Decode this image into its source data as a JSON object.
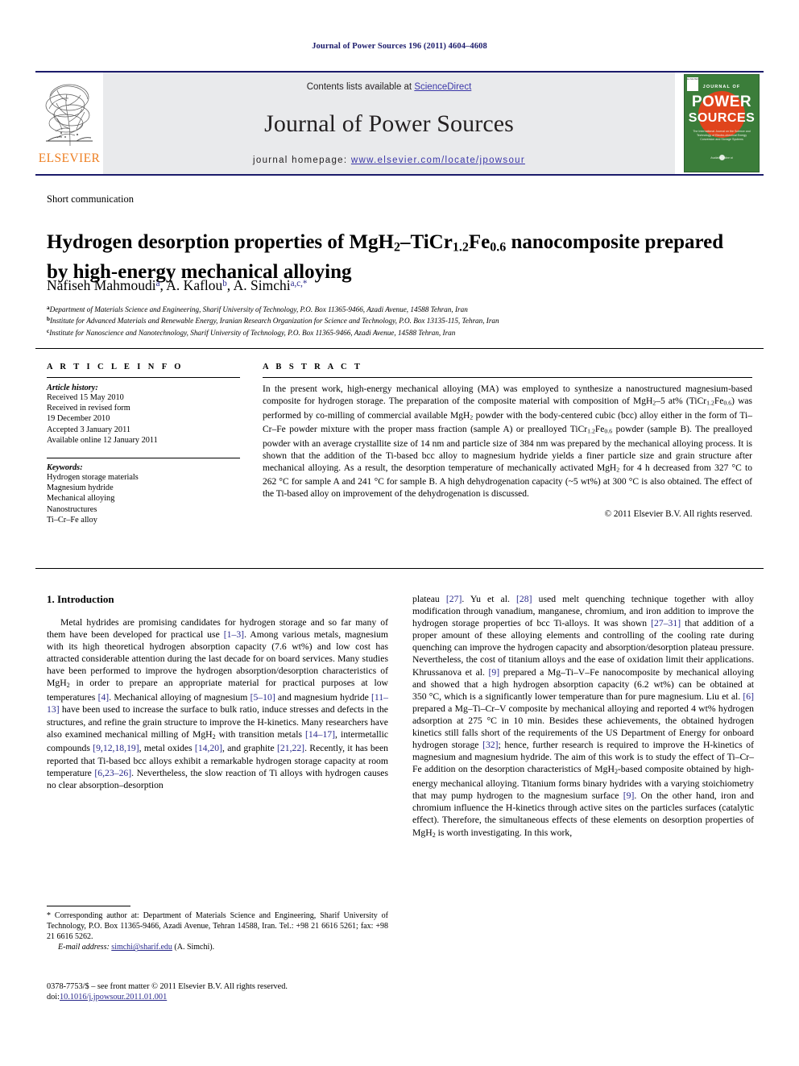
{
  "running_head": "Journal of Power Sources 196 (2011) 4604–4608",
  "masthead": {
    "contents_prefix": "Contents lists available at ",
    "sciencedirect": "ScienceDirect",
    "journal_name": "Journal of Power Sources",
    "homepage_prefix": "journal homepage: ",
    "homepage_url": "www.elsevier.com/locate/jpowsour",
    "publisher": "ELSEVIER",
    "publisher_logo_icon": "elsevier-tree-icon",
    "link_color": "#3b37a8",
    "rule_color": "#1b1b6b",
    "cover": {
      "line1": "JOURNAL OF",
      "line2": "POWER",
      "line3": "SOURCES",
      "tagline": "The International Journal on the Science and Technology of Electro-chemical Energy Conversion and Storage Systems",
      "footer": "Available online at",
      "bg_color": "#3b7d3a",
      "circle_color": "#e0441c"
    }
  },
  "article_type": "Short communication",
  "title_parts": {
    "p1": "Hydrogen desorption properties of MgH",
    "sub1": "2",
    "p2": "–TiCr",
    "sub2": "1.2",
    "p3": "Fe",
    "sub3": "0.6",
    "p4": " nanocomposite prepared by high-energy mechanical alloying"
  },
  "authors": [
    {
      "name": "Nafiseh Mahmoudi",
      "marks": "a"
    },
    {
      "name": "A. Kaflou",
      "marks": "b"
    },
    {
      "name": "A. Simchi",
      "marks": "a,c,*"
    }
  ],
  "affiliations": [
    {
      "mark": "a",
      "text": "Department of Materials Science and Engineering, Sharif University of Technology, P.O. Box 11365-9466, Azadi Avenue, 14588 Tehran, Iran"
    },
    {
      "mark": "b",
      "text": "Institute for Advanced Materials and Renewable Energy, Iranian Research Organization for Science and Technology, P.O. Box 13135-115, Tehran, Iran"
    },
    {
      "mark": "c",
      "text": "Institute for Nanoscience and Nanotechnology, Sharif University of Technology, P.O. Box 11365-9466, Azadi Avenue, 14588 Tehran, Iran"
    }
  ],
  "article_info": {
    "heading": "A R T I C L E  I N F O",
    "history_label": "Article history:",
    "history": [
      "Received 15 May 2010",
      "Received in revised form",
      "19 December 2010",
      "Accepted 3 January 2011",
      "Available online 12 January 2011"
    ],
    "keywords_label": "Keywords:",
    "keywords": [
      "Hydrogen storage materials",
      "Magnesium hydride",
      "Mechanical alloying",
      "Nanostructures",
      "Ti–Cr–Fe alloy"
    ]
  },
  "abstract": {
    "heading": "A B S T R A C T",
    "copyright": "© 2011 Elsevier B.V. All rights reserved."
  },
  "sections": {
    "intro_heading": "1. Introduction"
  },
  "footnote": {
    "corresponding": "* Corresponding author at: Department of Materials Science and Engineering, Sharif University of Technology, P.O. Box 11365-9466, Azadi Avenue, Tehran 14588, Iran. Tel.: +98 21 6616 5261; fax: +98 21 6616 5262.",
    "email_label": "E-mail address:",
    "email": "simchi@sharif.edu",
    "email_suffix": "(A. Simchi)."
  },
  "issn": {
    "line1": "0378-7753/$ – see front matter © 2011 Elsevier B.V. All rights reserved.",
    "doi_label": "doi:",
    "doi": "10.1016/j.jpowsour.2011.01.001"
  }
}
